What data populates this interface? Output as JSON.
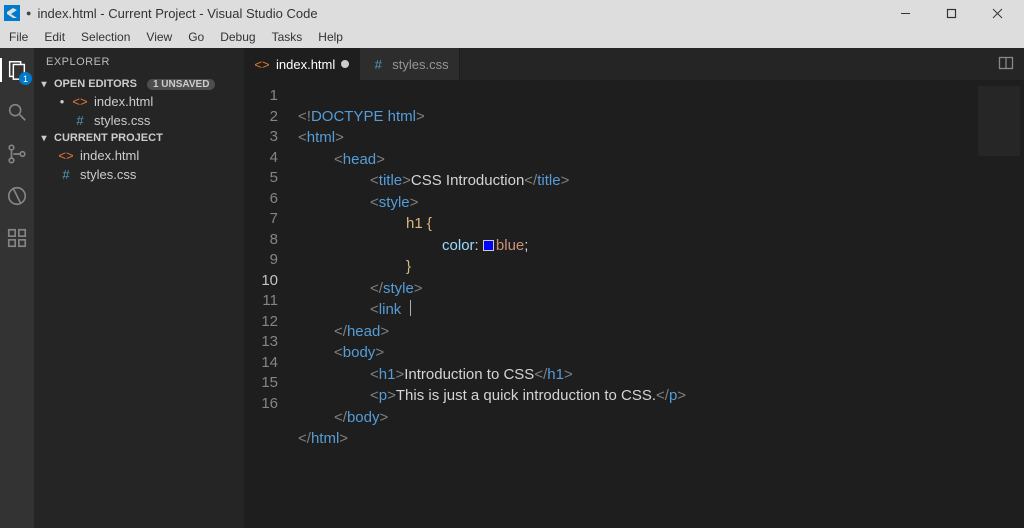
{
  "titlebar": {
    "title": "index.html - Current Project - Visual Studio Code",
    "dot": "●"
  },
  "menu": {
    "items": [
      "File",
      "Edit",
      "Selection",
      "View",
      "Go",
      "Debug",
      "Tasks",
      "Help"
    ]
  },
  "activity": {
    "explorer": "Explorer",
    "search": "Search",
    "git": "Source Control",
    "debug": "Debug",
    "extensions": "Extensions",
    "badge": "1"
  },
  "sidebar": {
    "title": "EXPLORER",
    "openeditors_label": "OPEN EDITORS",
    "openeditors_unsaved": "1 UNSAVED",
    "open": [
      {
        "name": "index.html",
        "type": "html",
        "dirty": true
      },
      {
        "name": "styles.css",
        "type": "css",
        "dirty": false
      }
    ],
    "project_label": "CURRENT PROJECT",
    "files": [
      {
        "name": "index.html",
        "type": "html"
      },
      {
        "name": "styles.css",
        "type": "css"
      }
    ]
  },
  "tabs": {
    "list": [
      {
        "name": "index.html",
        "type": "html",
        "active": true,
        "dirty": true
      },
      {
        "name": "styles.css",
        "type": "css",
        "active": false,
        "dirty": false
      }
    ]
  },
  "code": {
    "lines": [
      "1",
      "2",
      "3",
      "4",
      "5",
      "6",
      "7",
      "8",
      "9",
      "10",
      "11",
      "12",
      "13",
      "14",
      "15",
      "16"
    ],
    "current_line": "10",
    "t": {
      "doctype": "DOCTYPE html",
      "html": "html",
      "head": "head",
      "title": "title",
      "style": "style",
      "link": "link",
      "body": "body",
      "h1": "h1",
      "p": "p",
      "title_text": "CSS Introduction",
      "selector": "h1 {",
      "prop": "color",
      "colon": ": ",
      "color_val": "blue",
      "semicolon": ";",
      "closebrace": "}",
      "h1_text": "Introduction to CSS",
      "p_text": "This is just a quick introduction to CSS."
    }
  }
}
